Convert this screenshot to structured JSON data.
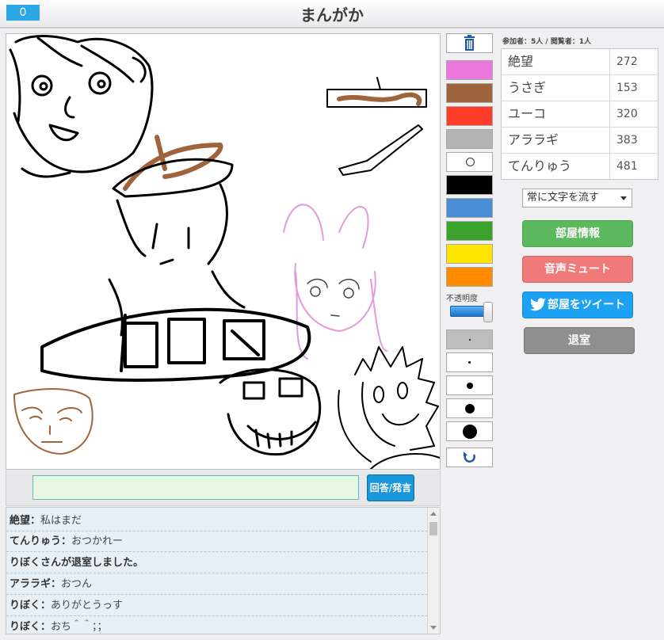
{
  "header": {
    "counter": "0",
    "title": "まんがか"
  },
  "canvas": {
    "drawing": "hand-drawn sketches"
  },
  "tools": {
    "trash_icon": "trash-icon",
    "colors": [
      "#ee77dd",
      "#a0643c",
      "#ff3b2a",
      "#b3b3b3",
      "#ffffff",
      "#000000",
      "#4a8fd6",
      "#3aa12a",
      "#ffe400",
      "#ff8a00"
    ],
    "opacity_label": "不透明度",
    "opacity_value": 0.95,
    "brush_sizes": [
      2,
      3,
      8,
      12,
      18
    ],
    "undo_icon": "undo-icon"
  },
  "stats": {
    "text": "参加者：5人 / 閲覧者：1人"
  },
  "players": [
    {
      "name": "絶望",
      "score": "272"
    },
    {
      "name": "うさぎ",
      "score": "153"
    },
    {
      "name": "ユーコ",
      "score": "320"
    },
    {
      "name": "アララギ",
      "score": "383"
    },
    {
      "name": "てんりゅう",
      "score": "481"
    }
  ],
  "mode_select": {
    "selected": "常に文字を流す"
  },
  "buttons": {
    "room_info": "部屋情報",
    "mute": "音声ミュート",
    "tweet": "部屋をツイート",
    "exit": "退室",
    "answer": "回答/発言"
  },
  "input": {
    "value": "",
    "placeholder": ""
  },
  "chat": [
    {
      "name": "絶望",
      "sep": "：",
      "msg": "私はまだ",
      "system": false
    },
    {
      "name": "てんりゅう",
      "sep": "：",
      "msg": "おつかれー",
      "system": false
    },
    {
      "name": "",
      "sep": "",
      "msg": "りぼくさんが退室しました。",
      "system": true
    },
    {
      "name": "アララギ",
      "sep": "：",
      "msg": "おつん",
      "system": false
    },
    {
      "name": "りぼく",
      "sep": "：",
      "msg": "ありがとうっす",
      "system": false
    },
    {
      "name": "りぼく",
      "sep": "：",
      "msg": "おち＾＾；；",
      "system": false
    }
  ]
}
